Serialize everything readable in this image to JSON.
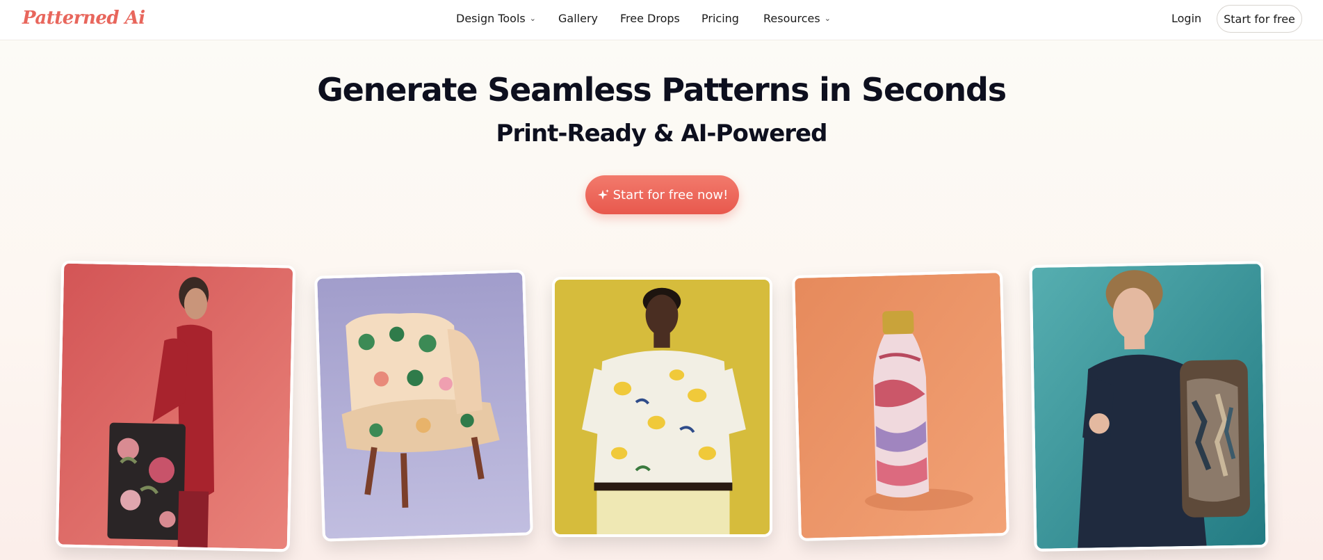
{
  "brand": {
    "logo": "Patterned Ai"
  },
  "nav": {
    "items": [
      {
        "label": "Design Tools",
        "dropdown": true
      },
      {
        "label": "Gallery",
        "dropdown": false
      },
      {
        "label": "Free Drops",
        "dropdown": false
      },
      {
        "label": "Pricing",
        "dropdown": false
      },
      {
        "label": "Resources",
        "dropdown": true
      }
    ],
    "login": "Login",
    "start": "Start for free"
  },
  "hero": {
    "title": "Generate Seamless Patterns in Seconds",
    "subtitle": "Print-Ready & AI-Powered",
    "cta": "Start for free now!",
    "cta_icon": "sparkle-icon"
  },
  "showcase": [
    {
      "subject": "woman-with-floral-tote-bag",
      "bg": "#d9605b"
    },
    {
      "subject": "tropical-print-armchair",
      "bg": "#a9a6cc"
    },
    {
      "subject": "man-in-lemon-print-shirt",
      "bg": "#d9c044"
    },
    {
      "subject": "marble-pattern-water-bottle",
      "bg": "#ee9266"
    },
    {
      "subject": "teen-with-patterned-backpack",
      "bg": "#3f9ea2"
    }
  ],
  "colors": {
    "accent": "#e8665c",
    "title": "#0d0f1e"
  }
}
